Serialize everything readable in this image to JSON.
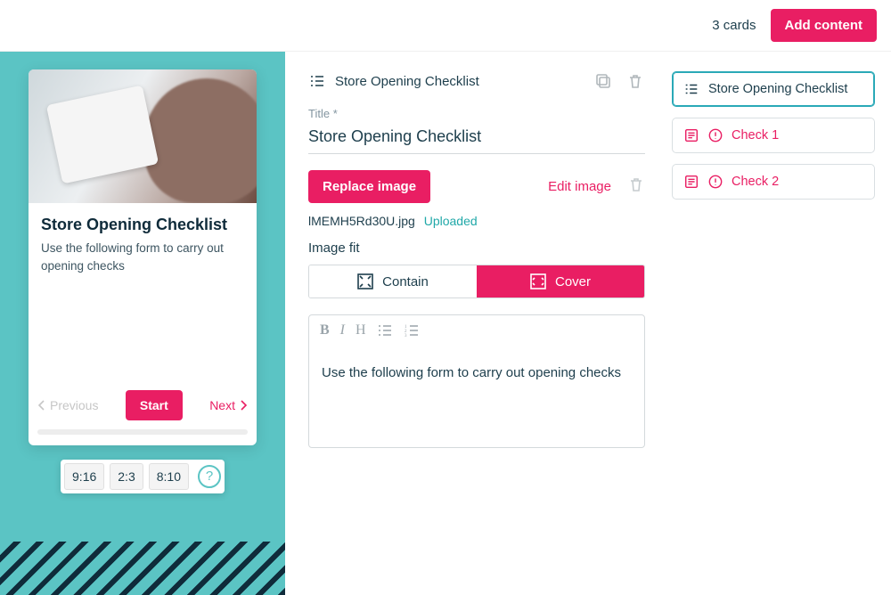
{
  "topbar": {
    "count_label": "3 cards",
    "add_content_label": "Add content"
  },
  "preview": {
    "title": "Store Opening Checklist",
    "body": "Use the following form to carry out opening checks",
    "prev_label": "Previous",
    "start_label": "Start",
    "next_label": "Next",
    "ratios": [
      "9:16",
      "2:3",
      "8:10"
    ]
  },
  "editor": {
    "header_title": "Store Opening Checklist",
    "title_field_label": "Title *",
    "title_value": "Store Opening Checklist",
    "replace_image_label": "Replace image",
    "edit_image_label": "Edit image",
    "filename": "lMEMH5Rd30U.jpg",
    "upload_status": "Uploaded",
    "image_fit_label": "Image fit",
    "contain_label": "Contain",
    "cover_label": "Cover",
    "rte_body": "Use the following form to carry out opening checks"
  },
  "cards": [
    {
      "label": "Store Opening Checklist",
      "state": "active"
    },
    {
      "label": "Check 1",
      "state": "error"
    },
    {
      "label": "Check 2",
      "state": "error"
    }
  ]
}
